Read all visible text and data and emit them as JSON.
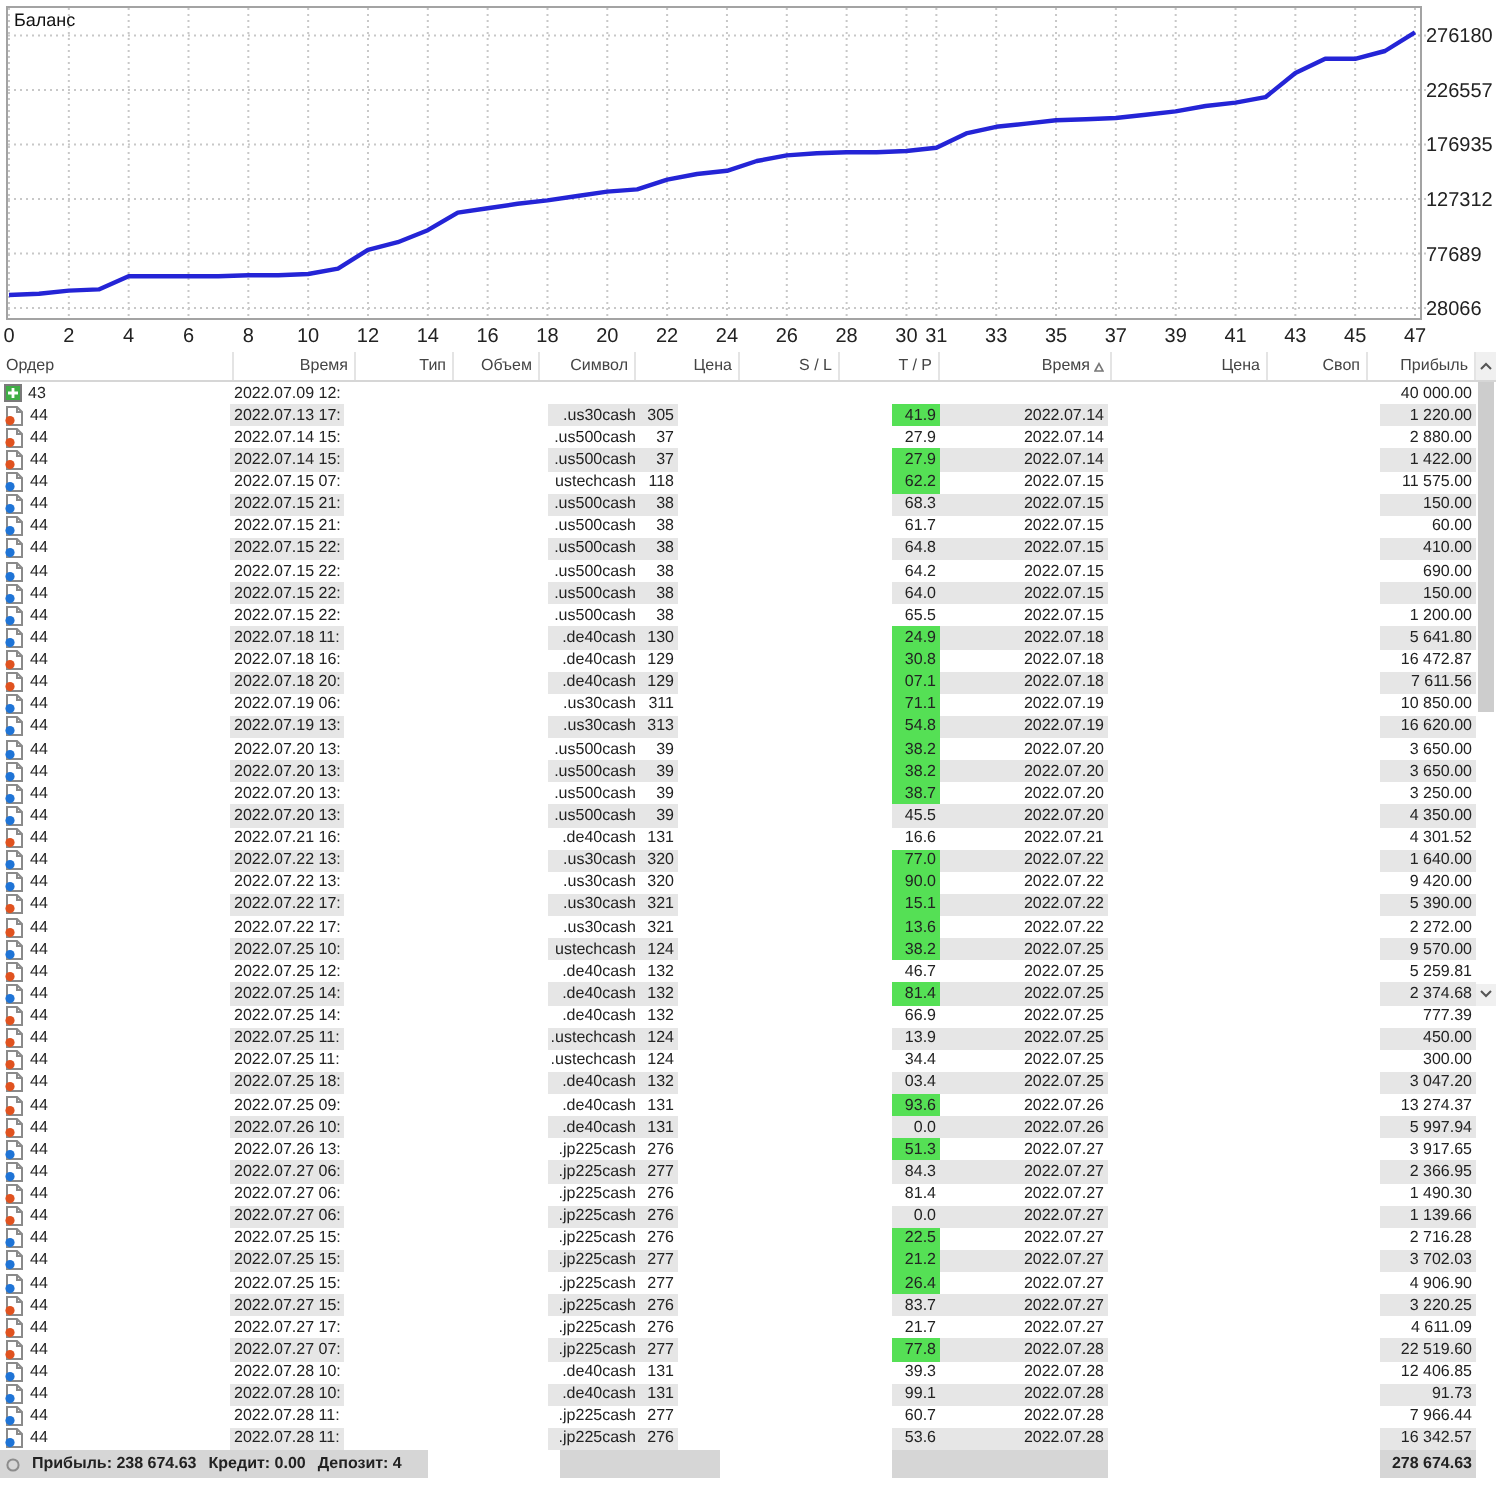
{
  "chart": {
    "chart_data": {
      "type": "line",
      "x": [
        0,
        1,
        2,
        3,
        4,
        5,
        6,
        7,
        8,
        9,
        10,
        11,
        12,
        13,
        14,
        15,
        16,
        17,
        18,
        19,
        20,
        21,
        22,
        23,
        24,
        25,
        26,
        27,
        28,
        29,
        30,
        31,
        32,
        33,
        34,
        35,
        36,
        37,
        38,
        39,
        40,
        41,
        42,
        43,
        44,
        45,
        46,
        47
      ],
      "series": [
        {
          "name": "Баланс",
          "color": "#2424d6",
          "values": [
            40000,
            41000,
            44000,
            45000,
            57000,
            57000,
            57000,
            57000,
            58000,
            58000,
            59000,
            64000,
            81000,
            88000,
            99000,
            115000,
            119000,
            123000,
            126000,
            130000,
            134000,
            136000,
            145000,
            150000,
            153000,
            162000,
            167000,
            169000,
            170000,
            170000,
            171000,
            174000,
            187000,
            193000,
            196000,
            199000,
            200000,
            201000,
            204000,
            207000,
            212000,
            215000,
            220000,
            242000,
            255000,
            255000,
            262000,
            279000
          ]
        }
      ],
      "xlim": [
        0,
        47
      ],
      "ylim": [
        19000,
        303000
      ],
      "xticks": [
        0,
        2,
        4,
        6,
        8,
        10,
        12,
        14,
        16,
        18,
        20,
        22,
        24,
        26,
        28,
        30,
        31,
        33,
        35,
        37,
        39,
        41,
        43,
        45,
        47
      ],
      "yticks": [
        28066,
        77689,
        127312,
        176935,
        226557,
        276180
      ],
      "grid": true
    }
  },
  "table": {
    "columns": [
      {
        "label": "Ордер",
        "sorted": false
      },
      {
        "label": "Время",
        "sorted": false
      },
      {
        "label": "Тип",
        "sorted": false
      },
      {
        "label": "Объем",
        "sorted": false
      },
      {
        "label": "Символ",
        "sorted": false
      },
      {
        "label": "Цена",
        "sorted": false
      },
      {
        "label": "S / L",
        "sorted": false
      },
      {
        "label": "T / P",
        "sorted": false
      },
      {
        "label": "Время",
        "sorted": true
      },
      {
        "label": "Цена",
        "sorted": false
      },
      {
        "label": "Своп",
        "sorted": false
      },
      {
        "label": "Прибыль",
        "sorted": false
      }
    ],
    "rows": [
      {
        "kind": "balance",
        "order": "43",
        "open_time": "2022.07.09 12:",
        "profit": "40 000.00"
      },
      {
        "kind": "sell",
        "order": "44",
        "open_time": "2022.07.13 17:",
        "symbol": ".us30cash",
        "price": "305",
        "tp": "41.9",
        "highlighted": true,
        "close_time": "2022.07.14",
        "profit": "1 220.00"
      },
      {
        "kind": "sell",
        "order": "44",
        "open_time": "2022.07.14 15:",
        "symbol": ".us500cash",
        "price": "37",
        "tp": "27.9",
        "highlighted": false,
        "close_time": "2022.07.14",
        "profit": "2 880.00"
      },
      {
        "kind": "sell",
        "order": "44",
        "open_time": "2022.07.14 15:",
        "symbol": ".us500cash",
        "price": "37",
        "tp": "27.9",
        "highlighted": true,
        "close_time": "2022.07.14",
        "profit": "1 422.00"
      },
      {
        "kind": "buy",
        "order": "44",
        "open_time": "2022.07.15 07:",
        "symbol": "ustechcash",
        "price": "118",
        "tp": "62.2",
        "highlighted": true,
        "close_time": "2022.07.15",
        "profit": "11 575.00"
      },
      {
        "kind": "buy",
        "order": "44",
        "open_time": "2022.07.15 21:",
        "symbol": ".us500cash",
        "price": "38",
        "tp": "68.3",
        "highlighted": false,
        "close_time": "2022.07.15",
        "profit": "150.00"
      },
      {
        "kind": "buy",
        "order": "44",
        "open_time": "2022.07.15 21:",
        "symbol": ".us500cash",
        "price": "38",
        "tp": "61.7",
        "highlighted": false,
        "close_time": "2022.07.15",
        "profit": "60.00"
      },
      {
        "kind": "buy",
        "order": "44",
        "open_time": "2022.07.15 22:",
        "symbol": ".us500cash",
        "price": "38",
        "tp": "64.8",
        "highlighted": false,
        "close_time": "2022.07.15",
        "profit": "410.00"
      },
      {
        "kind": "buy",
        "order": "44",
        "open_time": "2022.07.15 22:",
        "symbol": ".us500cash",
        "price": "38",
        "tp": "64.2",
        "highlighted": false,
        "close_time": "2022.07.15",
        "profit": "690.00"
      },
      {
        "kind": "buy",
        "order": "44",
        "open_time": "2022.07.15 22:",
        "symbol": ".us500cash",
        "price": "38",
        "tp": "64.0",
        "highlighted": false,
        "close_time": "2022.07.15",
        "profit": "150.00"
      },
      {
        "kind": "buy",
        "order": "44",
        "open_time": "2022.07.15 22:",
        "symbol": ".us500cash",
        "price": "38",
        "tp": "65.5",
        "highlighted": false,
        "close_time": "2022.07.15",
        "profit": "1 200.00"
      },
      {
        "kind": "buy",
        "order": "44",
        "open_time": "2022.07.18 11:",
        "symbol": ".de40cash",
        "price": "130",
        "tp": "24.9",
        "highlighted": true,
        "close_time": "2022.07.18",
        "profit": "5 641.80"
      },
      {
        "kind": "sell",
        "order": "44",
        "open_time": "2022.07.18 16:",
        "symbol": ".de40cash",
        "price": "129",
        "tp": "30.8",
        "highlighted": true,
        "close_time": "2022.07.18",
        "profit": "16 472.87"
      },
      {
        "kind": "sell",
        "order": "44",
        "open_time": "2022.07.18 20:",
        "symbol": ".de40cash",
        "price": "129",
        "tp": "07.1",
        "highlighted": true,
        "close_time": "2022.07.18",
        "profit": "7 611.56"
      },
      {
        "kind": "buy",
        "order": "44",
        "open_time": "2022.07.19 06:",
        "symbol": ".us30cash",
        "price": "311",
        "tp": "71.1",
        "highlighted": true,
        "close_time": "2022.07.19",
        "profit": "10 850.00"
      },
      {
        "kind": "buy",
        "order": "44",
        "open_time": "2022.07.19 13:",
        "symbol": ".us30cash",
        "price": "313",
        "tp": "54.8",
        "highlighted": true,
        "close_time": "2022.07.19",
        "profit": "16 620.00"
      },
      {
        "kind": "buy",
        "order": "44",
        "open_time": "2022.07.20 13:",
        "symbol": ".us500cash",
        "price": "39",
        "tp": "38.2",
        "highlighted": true,
        "close_time": "2022.07.20",
        "profit": "3 650.00"
      },
      {
        "kind": "buy",
        "order": "44",
        "open_time": "2022.07.20 13:",
        "symbol": ".us500cash",
        "price": "39",
        "tp": "38.2",
        "highlighted": true,
        "close_time": "2022.07.20",
        "profit": "3 650.00"
      },
      {
        "kind": "buy",
        "order": "44",
        "open_time": "2022.07.20 13:",
        "symbol": ".us500cash",
        "price": "39",
        "tp": "38.7",
        "highlighted": true,
        "close_time": "2022.07.20",
        "profit": "3 250.00"
      },
      {
        "kind": "buy",
        "order": "44",
        "open_time": "2022.07.20 13:",
        "symbol": ".us500cash",
        "price": "39",
        "tp": "45.5",
        "highlighted": false,
        "close_time": "2022.07.20",
        "profit": "4 350.00"
      },
      {
        "kind": "sell",
        "order": "44",
        "open_time": "2022.07.21 16:",
        "symbol": ".de40cash",
        "price": "131",
        "tp": "16.6",
        "highlighted": false,
        "close_time": "2022.07.21",
        "profit": "4 301.52"
      },
      {
        "kind": "buy",
        "order": "44",
        "open_time": "2022.07.22 13:",
        "symbol": ".us30cash",
        "price": "320",
        "tp": "77.0",
        "highlighted": true,
        "close_time": "2022.07.22",
        "profit": "1 640.00"
      },
      {
        "kind": "buy",
        "order": "44",
        "open_time": "2022.07.22 13:",
        "symbol": ".us30cash",
        "price": "320",
        "tp": "90.0",
        "highlighted": true,
        "close_time": "2022.07.22",
        "profit": "9 420.00"
      },
      {
        "kind": "sell",
        "order": "44",
        "open_time": "2022.07.22 17:",
        "symbol": ".us30cash",
        "price": "321",
        "tp": "15.1",
        "highlighted": true,
        "close_time": "2022.07.22",
        "profit": "5 390.00"
      },
      {
        "kind": "sell",
        "order": "44",
        "open_time": "2022.07.22 17:",
        "symbol": ".us30cash",
        "price": "321",
        "tp": "13.6",
        "highlighted": true,
        "close_time": "2022.07.22",
        "profit": "2 272.00"
      },
      {
        "kind": "buy",
        "order": "44",
        "open_time": "2022.07.25 10:",
        "symbol": "ustechcash",
        "price": "124",
        "tp": "38.2",
        "highlighted": true,
        "close_time": "2022.07.25",
        "profit": "9 570.00"
      },
      {
        "kind": "sell",
        "order": "44",
        "open_time": "2022.07.25 12:",
        "symbol": ".de40cash",
        "price": "132",
        "tp": "46.7",
        "highlighted": false,
        "close_time": "2022.07.25",
        "profit": "5 259.81"
      },
      {
        "kind": "buy",
        "order": "44",
        "open_time": "2022.07.25 14:",
        "symbol": ".de40cash",
        "price": "132",
        "tp": "81.4",
        "highlighted": true,
        "close_time": "2022.07.25",
        "profit": "2 374.68"
      },
      {
        "kind": "sell",
        "order": "44",
        "open_time": "2022.07.25 14:",
        "symbol": ".de40cash",
        "price": "132",
        "tp": "66.9",
        "highlighted": false,
        "close_time": "2022.07.25",
        "profit": "777.39"
      },
      {
        "kind": "sell",
        "order": "44",
        "open_time": "2022.07.25 11:",
        "symbol": ".ustechcash",
        "price": "124",
        "tp": "13.9",
        "highlighted": false,
        "close_time": "2022.07.25",
        "profit": "450.00"
      },
      {
        "kind": "sell",
        "order": "44",
        "open_time": "2022.07.25 11:",
        "symbol": ".ustechcash",
        "price": "124",
        "tp": "34.4",
        "highlighted": false,
        "close_time": "2022.07.25",
        "profit": "300.00"
      },
      {
        "kind": "sell",
        "order": "44",
        "open_time": "2022.07.25 18:",
        "symbol": ".de40cash",
        "price": "132",
        "tp": "03.4",
        "highlighted": false,
        "close_time": "2022.07.25",
        "profit": "3 047.20"
      },
      {
        "kind": "sell",
        "order": "44",
        "open_time": "2022.07.25 09:",
        "symbol": ".de40cash",
        "price": "131",
        "tp": "93.6",
        "highlighted": true,
        "close_time": "2022.07.26",
        "profit": "13 274.37"
      },
      {
        "kind": "sell",
        "order": "44",
        "open_time": "2022.07.26 10:",
        "symbol": ".de40cash",
        "price": "131",
        "tp": "0.0",
        "highlighted": false,
        "close_time": "2022.07.26",
        "profit": "5 997.94"
      },
      {
        "kind": "buy",
        "order": "44",
        "open_time": "2022.07.26 13:",
        "symbol": ".jp225cash",
        "price": "276",
        "tp": "51.3",
        "highlighted": true,
        "close_time": "2022.07.27",
        "profit": "3 917.65"
      },
      {
        "kind": "buy",
        "order": "44",
        "open_time": "2022.07.27 06:",
        "symbol": ".jp225cash",
        "price": "277",
        "tp": "84.3",
        "highlighted": false,
        "close_time": "2022.07.27",
        "profit": "2 366.95"
      },
      {
        "kind": "sell",
        "order": "44",
        "open_time": "2022.07.27 06:",
        "symbol": ".jp225cash",
        "price": "276",
        "tp": "81.4",
        "highlighted": false,
        "close_time": "2022.07.27",
        "profit": "1 490.30"
      },
      {
        "kind": "sell",
        "order": "44",
        "open_time": "2022.07.27 06:",
        "symbol": ".jp225cash",
        "price": "276",
        "tp": "0.0",
        "highlighted": false,
        "close_time": "2022.07.27",
        "profit": "1 139.66"
      },
      {
        "kind": "buy",
        "order": "44",
        "open_time": "2022.07.25 15:",
        "symbol": ".jp225cash",
        "price": "276",
        "tp": "22.5",
        "highlighted": true,
        "close_time": "2022.07.27",
        "profit": "2 716.28"
      },
      {
        "kind": "buy",
        "order": "44",
        "open_time": "2022.07.25 15:",
        "symbol": ".jp225cash",
        "price": "277",
        "tp": "21.2",
        "highlighted": true,
        "close_time": "2022.07.27",
        "profit": "3 702.03"
      },
      {
        "kind": "buy",
        "order": "44",
        "open_time": "2022.07.25 15:",
        "symbol": ".jp225cash",
        "price": "277",
        "tp": "26.4",
        "highlighted": true,
        "close_time": "2022.07.27",
        "profit": "4 906.90"
      },
      {
        "kind": "sell",
        "order": "44",
        "open_time": "2022.07.27 15:",
        "symbol": ".jp225cash",
        "price": "276",
        "tp": "83.7",
        "highlighted": false,
        "close_time": "2022.07.27",
        "profit": "3 220.25"
      },
      {
        "kind": "sell",
        "order": "44",
        "open_time": "2022.07.27 17:",
        "symbol": ".jp225cash",
        "price": "276",
        "tp": "21.7",
        "highlighted": false,
        "close_time": "2022.07.27",
        "profit": "4 611.09"
      },
      {
        "kind": "sell",
        "order": "44",
        "open_time": "2022.07.27 07:",
        "symbol": ".jp225cash",
        "price": "277",
        "tp": "77.8",
        "highlighted": true,
        "close_time": "2022.07.28",
        "profit": "22 519.60"
      },
      {
        "kind": "buy",
        "order": "44",
        "open_time": "2022.07.28 10:",
        "symbol": ".de40cash",
        "price": "131",
        "tp": "39.3",
        "highlighted": false,
        "close_time": "2022.07.28",
        "profit": "12 406.85"
      },
      {
        "kind": "buy",
        "order": "44",
        "open_time": "2022.07.28 10:",
        "symbol": ".de40cash",
        "price": "131",
        "tp": "99.1",
        "highlighted": false,
        "close_time": "2022.07.28",
        "profit": "91.73"
      },
      {
        "kind": "buy",
        "order": "44",
        "open_time": "2022.07.28 11:",
        "symbol": ".jp225cash",
        "price": "277",
        "tp": "60.7",
        "highlighted": false,
        "close_time": "2022.07.28",
        "profit": "7 966.44"
      },
      {
        "kind": "buy",
        "order": "44",
        "open_time": "2022.07.28 11:",
        "symbol": ".jp225cash",
        "price": "276",
        "tp": "53.6",
        "highlighted": false,
        "close_time": "2022.07.28",
        "profit": "16 342.57"
      }
    ]
  },
  "status_bar": {
    "items": [
      "Прибыль: 238 674.63",
      "Кредит: 0.00",
      "Депозит: 4"
    ],
    "total": "278 674.63"
  }
}
